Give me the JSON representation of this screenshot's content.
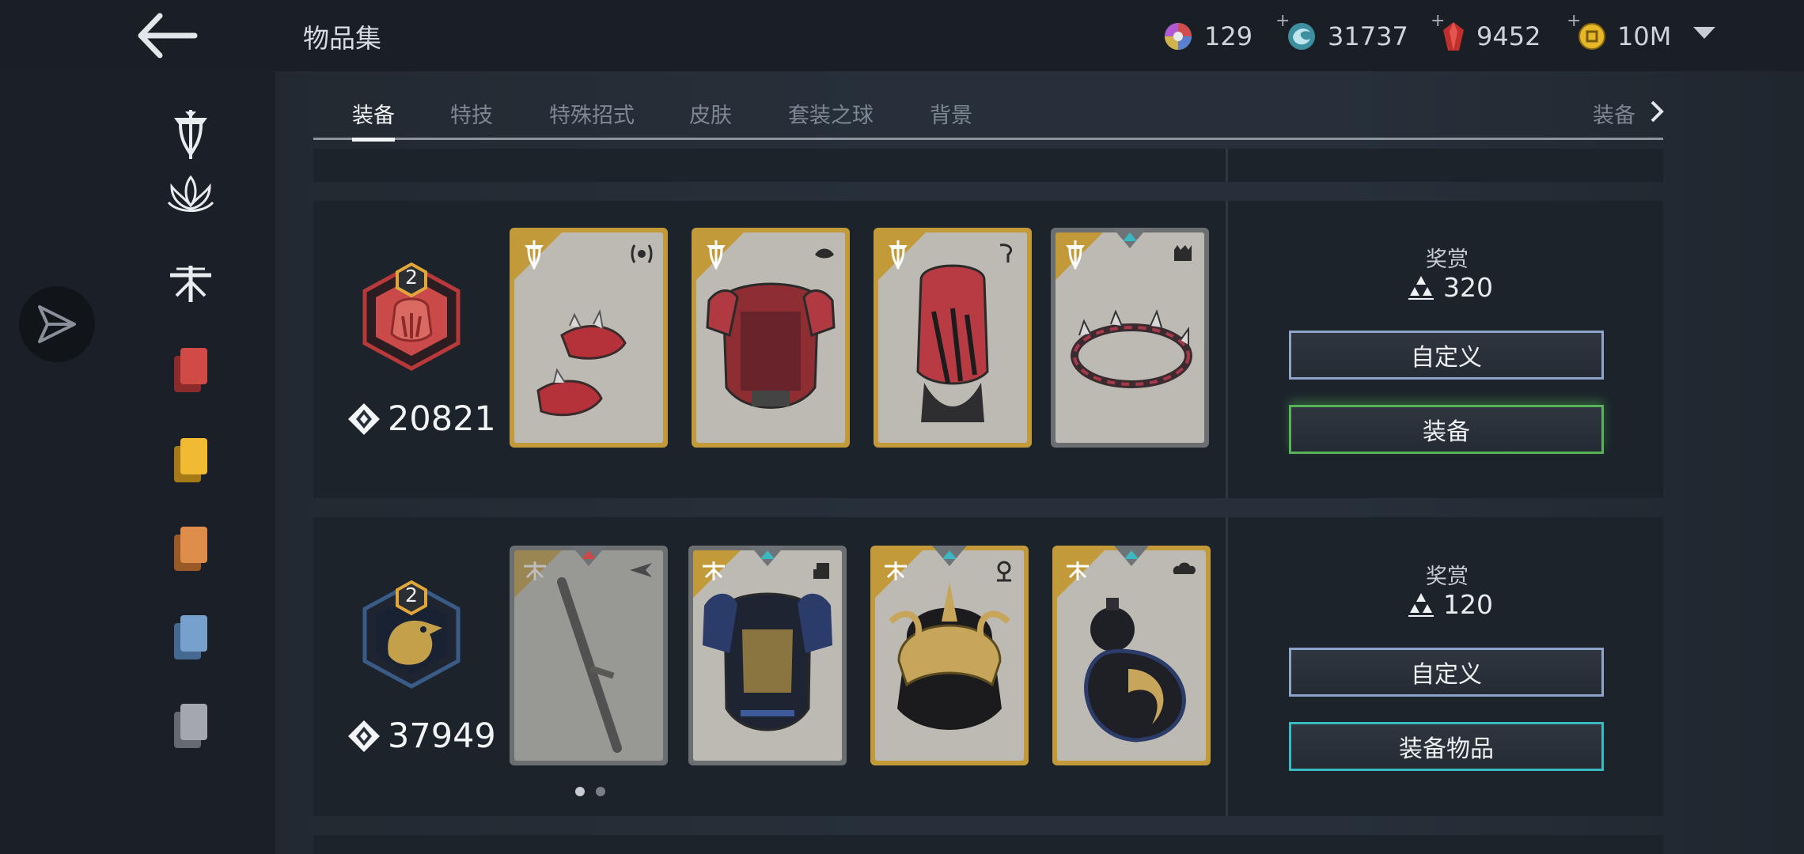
{
  "header": {
    "title": "物品集",
    "currencies": [
      {
        "name": "color-orb",
        "value": "129"
      },
      {
        "name": "steel",
        "value": "31737"
      },
      {
        "name": "gem",
        "value": "9452"
      },
      {
        "name": "coin",
        "value": "10M"
      }
    ],
    "plus": "+"
  },
  "tabs": [
    "装备",
    "特技",
    "特殊招式",
    "皮肤",
    "套装之球",
    "背景"
  ],
  "tab_next_label": "装备",
  "sets": [
    {
      "level": "2",
      "score": "20821",
      "reward_label": "奖赏",
      "reward_value": "320",
      "customize_label": "自定义",
      "equip_label": "装备"
    },
    {
      "level": "2",
      "score": "37949",
      "reward_label": "奖赏",
      "reward_value": "120",
      "customize_label": "自定义",
      "equip_label": "装备物品"
    }
  ],
  "colors": {
    "accent_gold": "#c29a3a",
    "equip_green": "#57b258",
    "equip_teal": "#3ab9c3",
    "customize_blue": "#8ea3c9",
    "red": "#c9423f",
    "yellow": "#e9b631",
    "orange": "#d98a47",
    "light_blue": "#6f98c6",
    "grey": "#9a9da4"
  },
  "pagination": {
    "total": 2,
    "current": 1
  }
}
